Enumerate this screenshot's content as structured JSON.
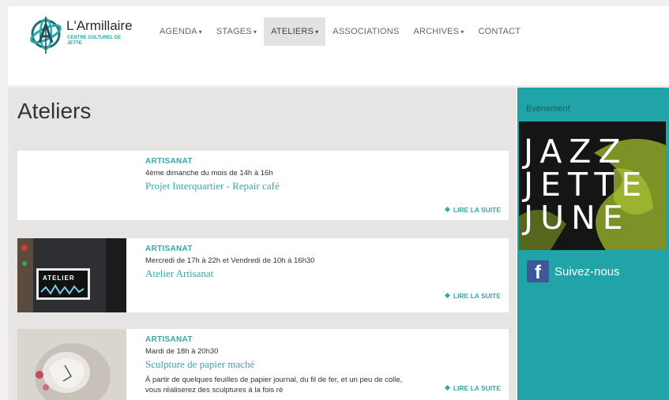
{
  "header": {
    "logo_name": "L'Armillaire",
    "logo_subtitle": "Centre culturel de Jette",
    "nav": [
      {
        "label": "AGENDA",
        "caret": true
      },
      {
        "label": "STAGES",
        "caret": true
      },
      {
        "label": "ATELIERS",
        "caret": true,
        "active": true
      },
      {
        "label": "ASSOCIATIONS",
        "caret": false
      },
      {
        "label": "ARCHIVES",
        "caret": true
      },
      {
        "label": "CONTACT",
        "caret": false
      }
    ],
    "caret_glyph": "▾"
  },
  "main": {
    "page_title": "Ateliers",
    "cards": [
      {
        "category": "ARTISANAT",
        "schedule": "4ème dimanche du mois de 14h à 16h",
        "title": "Projet Interquartier - Repair café",
        "more": "LIRE LA SUITE"
      },
      {
        "category": "ARTISANAT",
        "schedule": "Mercredi de 17h à 22h et Vendredi de 10h à 16h30",
        "title": "Atelier Artisanat",
        "thumb_text": "ATELIER",
        "more": "LIRE LA SUITE"
      },
      {
        "category": "ARTISANAT",
        "schedule": "Mardi de 18h à 20h30",
        "title": "Sculpture de papier maché",
        "description": "À partir de quelques feuilles de papier journal, du fil de fer, et un peu de colle, vous réaliserez des sculptures à la fois ré",
        "more": "LIRE LA SUITE"
      }
    ]
  },
  "sidebar": {
    "label": "Evénement",
    "poster_lines": [
      "JAZZ",
      "JETTE",
      "JUNE"
    ],
    "social_label": "Suivez-nous",
    "social_icon": "f"
  },
  "colors": {
    "accent": "#3aa6a6",
    "sidebar": "#20a4a8",
    "facebook": "#3b5998"
  }
}
